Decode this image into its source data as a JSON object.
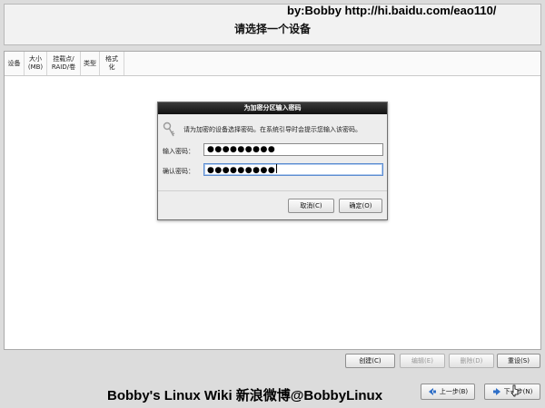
{
  "header": {
    "watermark": "by:Bobby  http://hi.baidu.com/eao110/",
    "title": "请选择一个设备"
  },
  "table": {
    "columns": [
      {
        "label": "设备"
      },
      {
        "label": "大小\n(MB)"
      },
      {
        "label": "挂载点/\nRAID/卷"
      },
      {
        "label": "类型"
      },
      {
        "label": "格式化"
      }
    ]
  },
  "dialog": {
    "title": "为加密分区输入密码",
    "message": "请为加密的设备选择密码。在系统引导时会提示您输入该密码。",
    "password_label": "输入密码：",
    "password_value": "●●●●●●●●●",
    "confirm_label": "确认密码：",
    "confirm_value": "●●●●●●●●●",
    "cancel_label": "取消(C)",
    "ok_label": "确定(O)",
    "icon": "key-icon"
  },
  "actions": {
    "create_label": "创建(C)",
    "edit_label": "编辑(E)",
    "delete_label": "删除(D)",
    "reset_label": "重设(S)"
  },
  "footer": {
    "text": "Bobby's Linux Wiki    新浪微博@BobbyLinux",
    "back_label": "上一步(B)",
    "next_label": "下一步(N)"
  }
}
